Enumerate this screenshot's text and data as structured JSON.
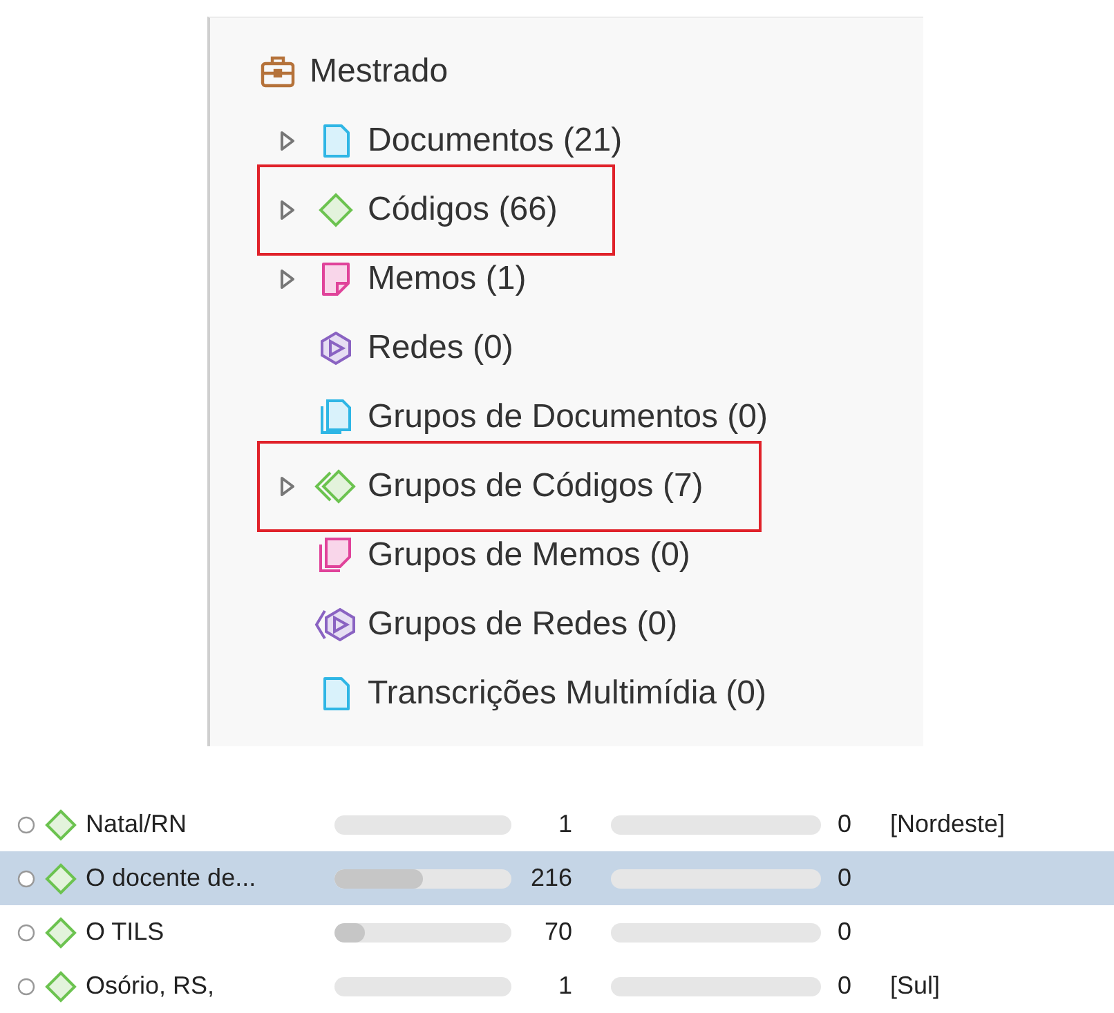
{
  "tree": {
    "label": "Mestrado",
    "children": [
      {
        "kind": "documents",
        "label": "Documentos (21)",
        "expanded": false,
        "highlighted": false
      },
      {
        "kind": "codes",
        "label": "Códigos (66)",
        "expanded": false,
        "highlighted": true
      },
      {
        "kind": "memos",
        "label": "Memos (1)",
        "expanded": false,
        "highlighted": false
      },
      {
        "kind": "networks",
        "label": "Redes (0)",
        "highlighted": false
      },
      {
        "kind": "document-groups",
        "label": "Grupos de Documentos (0)",
        "highlighted": false
      },
      {
        "kind": "code-groups",
        "label": "Grupos de Códigos (7)",
        "expanded": false,
        "highlighted": true
      },
      {
        "kind": "memo-groups",
        "label": "Grupos de Memos (0)",
        "highlighted": false
      },
      {
        "kind": "network-groups",
        "label": "Grupos de Redes (0)",
        "highlighted": false
      },
      {
        "kind": "multimedia",
        "label": "Transcrições Multimídia (0)",
        "highlighted": false
      }
    ]
  },
  "code_list": [
    {
      "name": "Natal/RN",
      "selected": false,
      "count_1": "1",
      "count_2": "0",
      "group": "[Nordeste]"
    },
    {
      "name": "O docente de...",
      "selected": true,
      "bar_1": {
        "level": 0.5
      },
      "count_1": "216",
      "count_2": "0"
    },
    {
      "name": "O TILS",
      "selected": false,
      "bar_1": {
        "level": 0.17
      },
      "count_1": "70",
      "count_2": "0"
    },
    {
      "name": "Osório, RS,",
      "selected": false,
      "count_1": "1",
      "count_2": "0",
      "group": "[Sul]"
    }
  ]
}
